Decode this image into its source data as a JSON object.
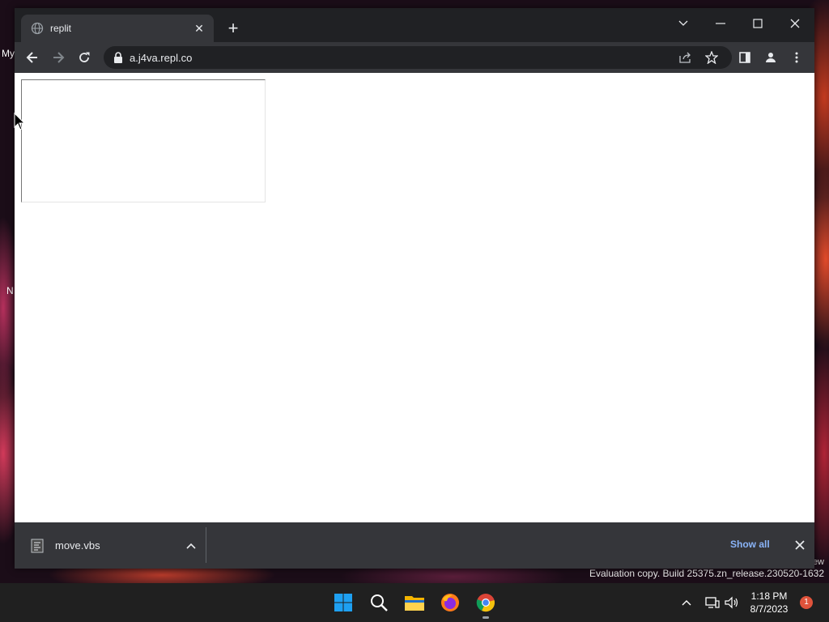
{
  "desktop": {
    "icon_labels": [
      "My",
      "N"
    ],
    "watermark_tail": "ew",
    "watermark": "Evaluation copy. Build 25375.zn_release.230520-1632"
  },
  "browser": {
    "tab": {
      "title": "replit"
    },
    "address": {
      "url": "a.j4va.repl.co"
    }
  },
  "downloads": {
    "item_name": "move.vbs",
    "show_all_label": "Show all"
  },
  "taskbar": {
    "apps": [
      "start",
      "search",
      "file-explorer",
      "firefox",
      "chrome"
    ],
    "clock": {
      "time": "1:18 PM",
      "date": "8/7/2023"
    },
    "notification_count": "1"
  },
  "colors": {
    "chrome_dark": "#202124",
    "chrome_toolbar": "#35363a",
    "link": "#8ab4f8",
    "windows_blue": "#0078d4"
  }
}
